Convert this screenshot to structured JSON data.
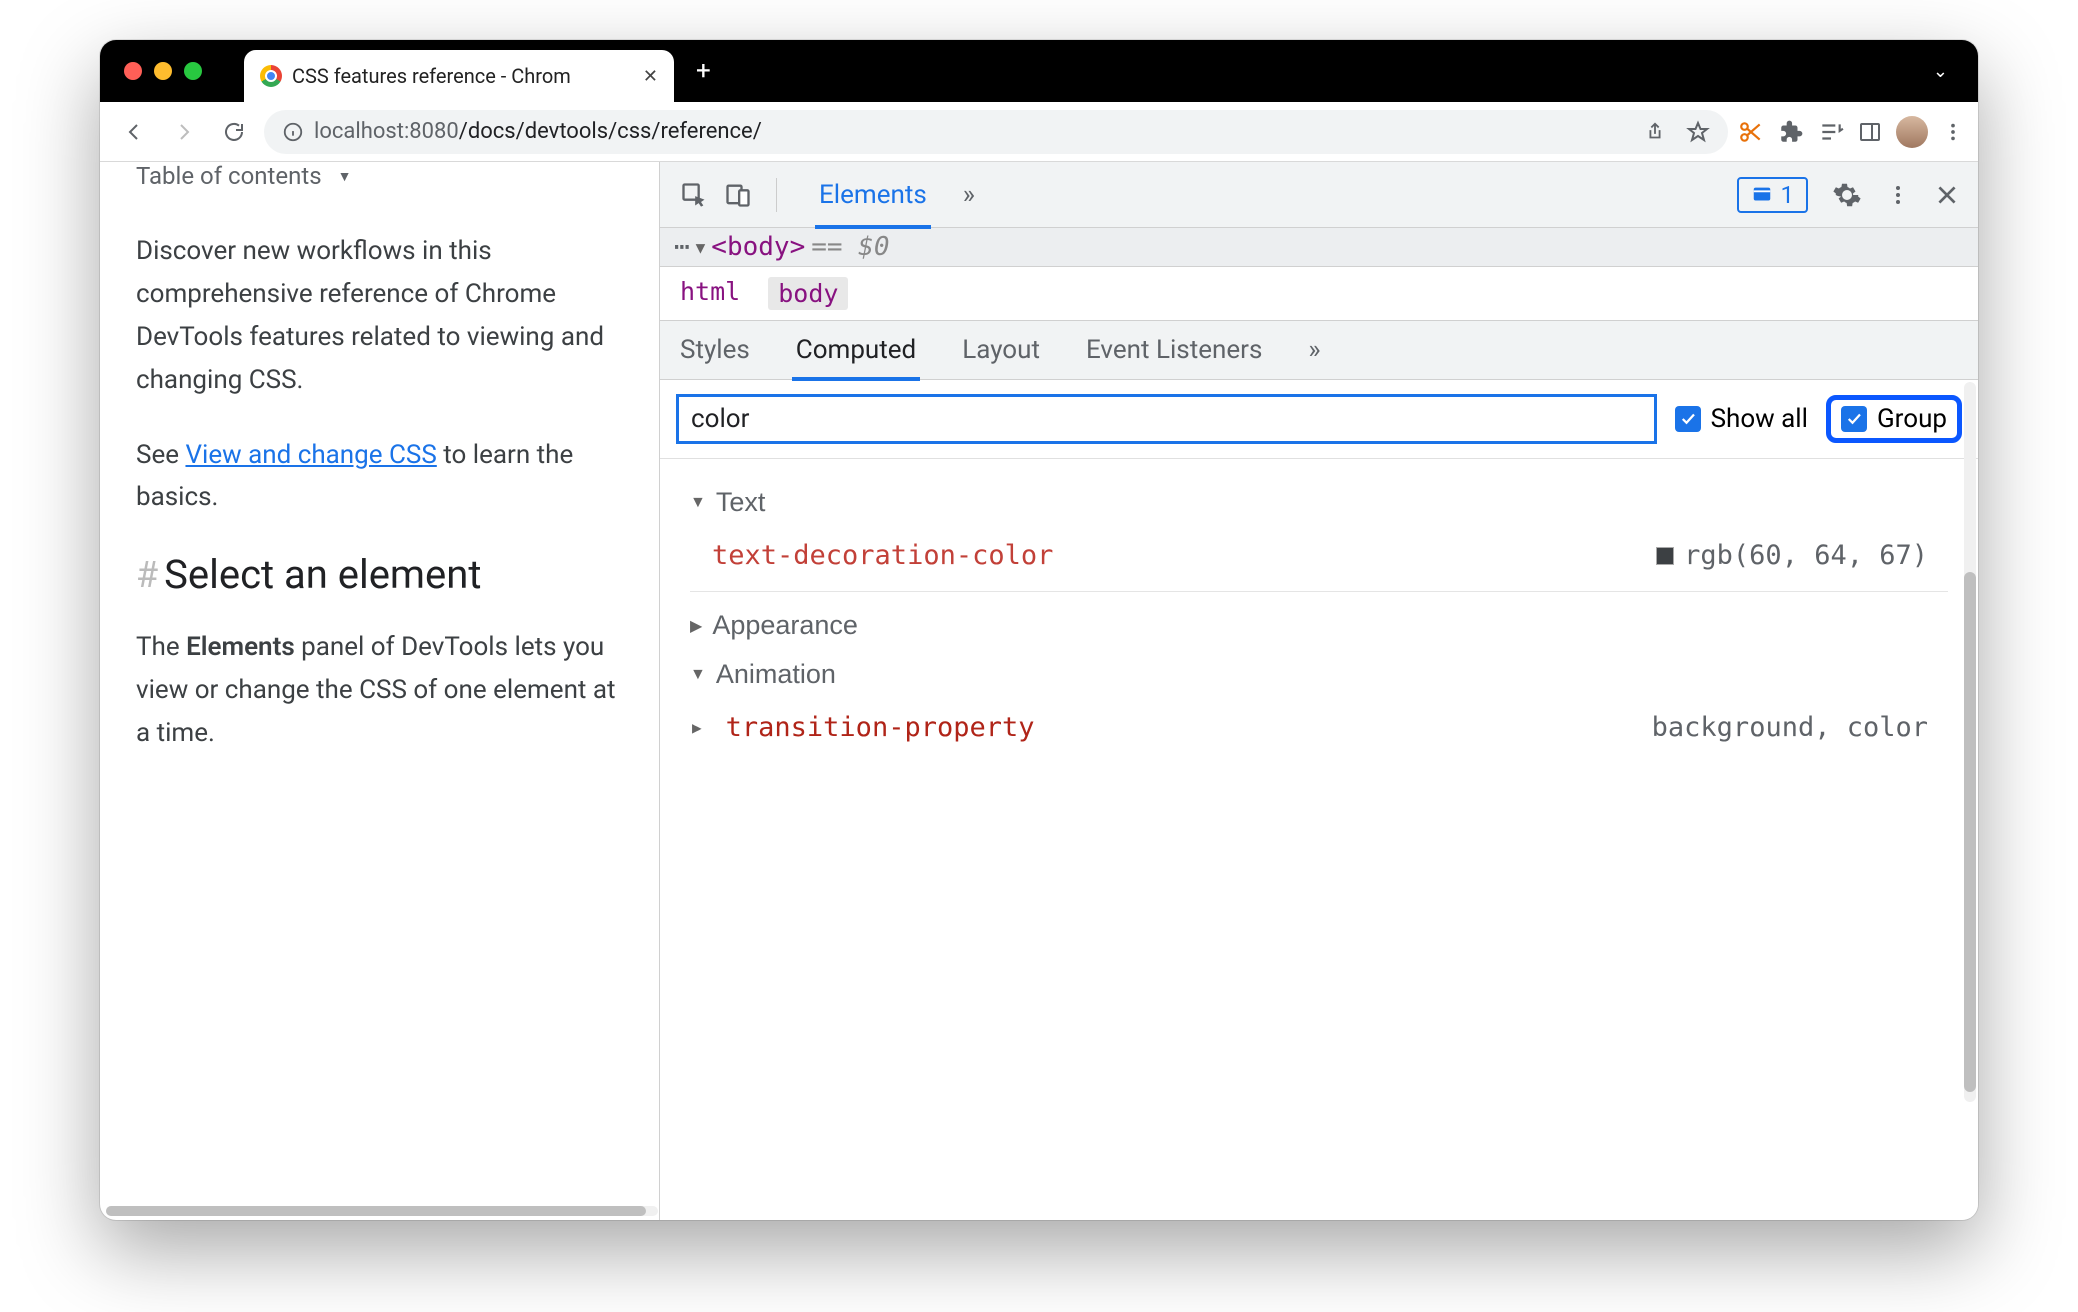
{
  "browser": {
    "tab_title": "CSS features reference - Chrom",
    "url_host": "localhost",
    "url_port": ":8080",
    "url_path": "/docs/devtools/css/reference/"
  },
  "page": {
    "toc_label": "Table of contents",
    "intro": "Discover new workflows in this comprehensive reference of Chrome DevTools features related to viewing and changing CSS.",
    "see_prefix": "See ",
    "see_link": "View and change CSS",
    "see_suffix": " to learn the basics.",
    "h2": "Select an element",
    "para2_a": "The ",
    "para2_b": "Elements",
    "para2_c": " panel of DevTools lets you view or change the CSS of one element at a time."
  },
  "devtools": {
    "main_tabs": {
      "elements": "Elements"
    },
    "issues_count": "1",
    "dom": {
      "tag": "<body>",
      "eq": "== $0",
      "ellipsis": "⋯"
    },
    "crumbs": {
      "html": "html",
      "body": "body"
    },
    "subtabs": {
      "styles": "Styles",
      "computed": "Computed",
      "layout": "Layout",
      "listeners": "Event Listeners"
    },
    "filter": {
      "value": "color",
      "show_all": "Show all",
      "group": "Group"
    },
    "groups": {
      "text": {
        "label": "Text",
        "expanded": true,
        "prop": "text-decoration-color",
        "val": "rgb(60, 64, 67)"
      },
      "appearance": {
        "label": "Appearance",
        "expanded": false
      },
      "animation": {
        "label": "Animation",
        "expanded": true,
        "prop": "transition-property",
        "val": "background, color"
      }
    }
  }
}
